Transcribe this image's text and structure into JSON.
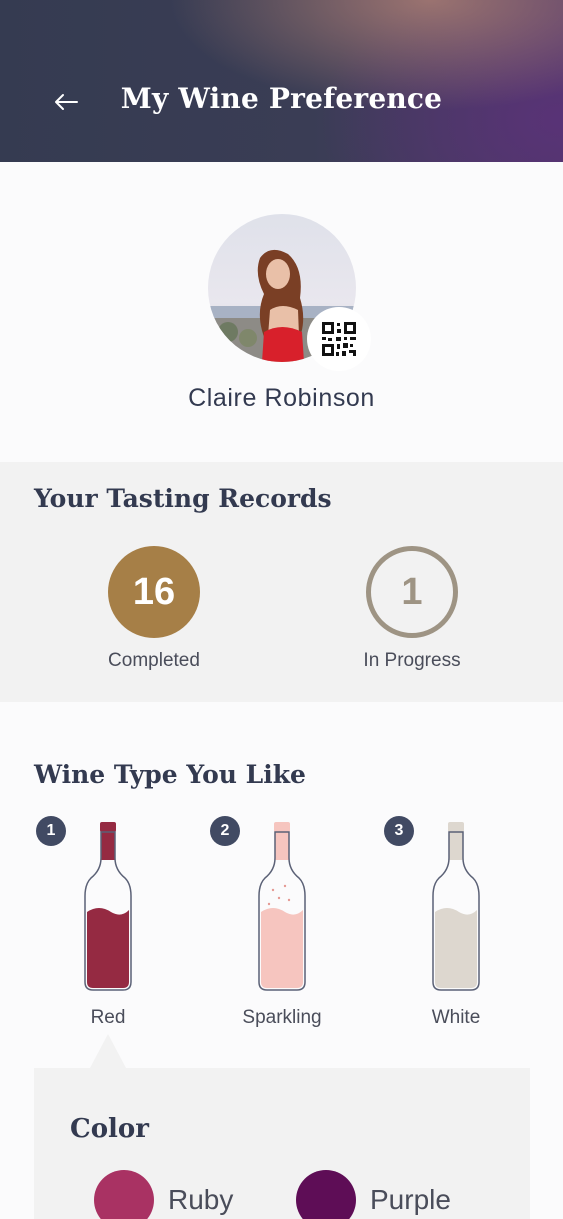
{
  "header": {
    "title": "My Wine Preference",
    "back_icon": "arrow-left-icon"
  },
  "profile": {
    "name": "Claire Robinson",
    "avatar_icon": "profile-photo",
    "qr_icon": "qr-code-icon"
  },
  "tasting_records": {
    "title": "Your Tasting Records",
    "completed": {
      "count": "16",
      "label": "Completed",
      "color": "#a67f47"
    },
    "in_progress": {
      "count": "1",
      "label": "In Progress",
      "color": "#9e9484"
    }
  },
  "wine_types": {
    "title": "Wine Type You Like",
    "items": [
      {
        "rank": "1",
        "label": "Red",
        "color": "#952a42",
        "icon": "red-wine-bottle-icon",
        "fill_level": 0.56
      },
      {
        "rank": "2",
        "label": "Sparkling",
        "color": "#f6c5bf",
        "icon": "sparkling-wine-bottle-icon",
        "fill_level": 0.56
      },
      {
        "rank": "3",
        "label": "White",
        "color": "#ddd7cf",
        "icon": "white-wine-bottle-icon",
        "fill_level": 0.56
      }
    ]
  },
  "color_panel": {
    "title": "Color",
    "options": [
      {
        "label": "Ruby",
        "color": "#a93263"
      },
      {
        "label": "Purple",
        "color": "#5e0d56"
      }
    ]
  }
}
